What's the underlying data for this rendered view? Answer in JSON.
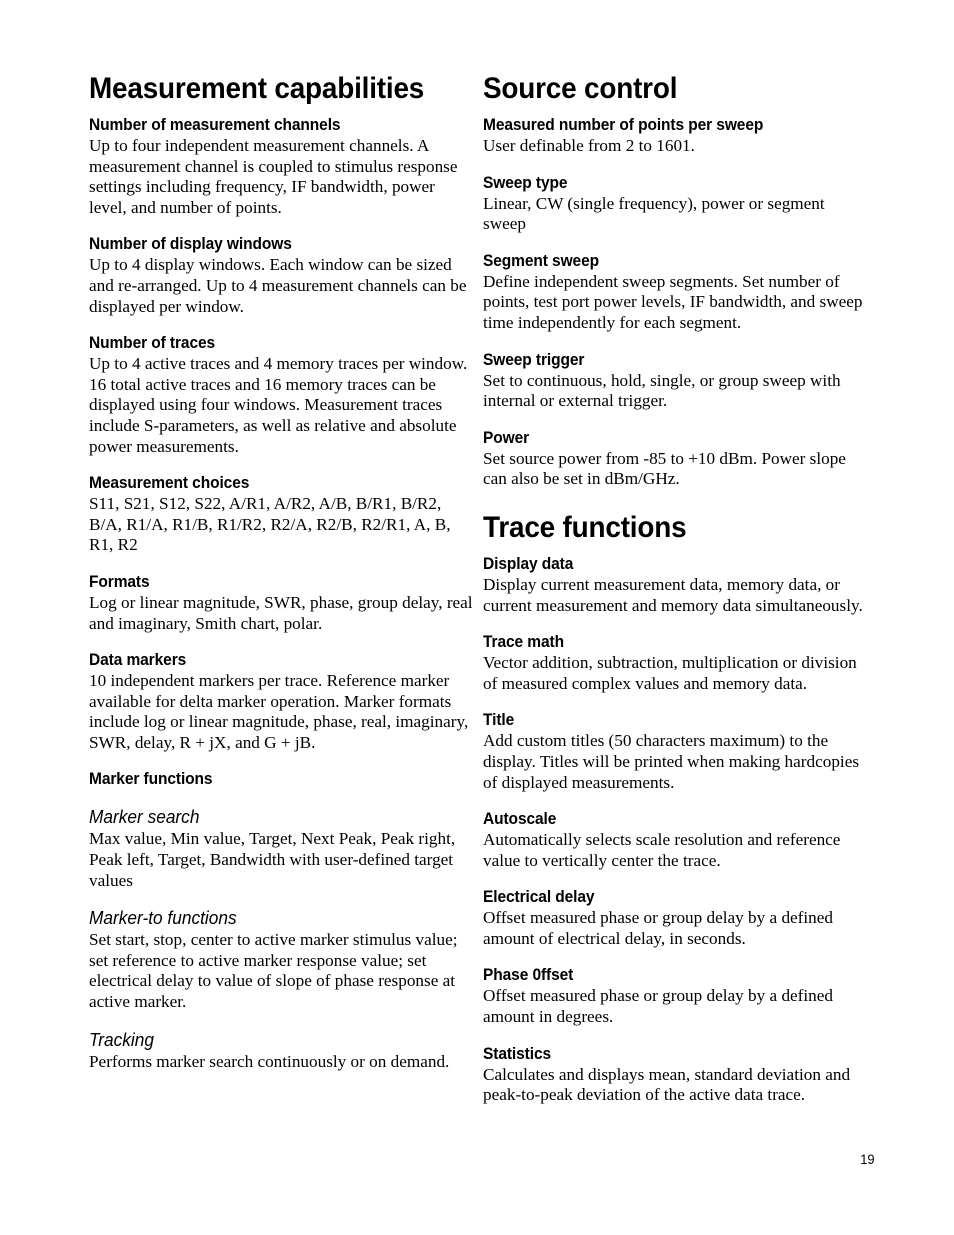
{
  "page": {
    "number": "19",
    "background": "#ffffff",
    "text_color": "#000000"
  },
  "left_column": {
    "title": "Measurement capabilities",
    "blocks": [
      {
        "heading": "Number of measurement channels",
        "body": "Up to four independent measurement channels. A measurement channel is coupled to stimulus response settings including frequency, IF bandwidth, power level, and number of points."
      },
      {
        "heading": "Number of display windows",
        "body": "Up to 4 display windows. Each window can be sized and re-arranged. Up to 4 measurement channels can be displayed per window."
      },
      {
        "heading": "Number of traces",
        "body": "Up to 4 active traces and 4 memory traces per window. 16 total active traces and 16 memory traces can be displayed using four windows. Measurement traces include S-parameters, as well as relative and absolute power measurements."
      },
      {
        "heading": "Measurement choices",
        "body": "S11, S21, S12, S22, A/R1, A/R2, A/B, B/R1, B/R2, B/A, R1/A, R1/B, R1/R2, R2/A, R2/B, R2/R1, A, B, R1, R2"
      },
      {
        "heading": "Formats",
        "body": "Log or linear magnitude, SWR, phase, group delay, real and imaginary, Smith chart, polar."
      },
      {
        "heading": "Data markers",
        "body": "10 independent markers per trace. Reference marker available for delta marker operation. Marker formats include log or linear magnitude, phase, real, imaginary, SWR, delay, R + jX, and G + jB."
      },
      {
        "heading": "Marker functions",
        "body": ""
      }
    ],
    "marker_subsections": [
      {
        "heading": "Marker search",
        "body": "Max value, Min value, Target, Next Peak, Peak right, Peak left, Target, Bandwidth with user-defined target values"
      },
      {
        "heading": "Marker-to functions",
        "body": "Set start, stop, center to active marker stimulus value; set reference to active marker response value; set electrical delay to value of slope of phase response at active marker."
      },
      {
        "heading": "Tracking",
        "body": "Performs marker search continuously or on demand."
      }
    ]
  },
  "right_column": {
    "title_1": "Source control",
    "blocks_1": [
      {
        "heading": "Measured number of points per sweep",
        "body": "User definable from 2 to 1601."
      },
      {
        "heading": "Sweep type",
        "body": "Linear, CW (single frequency), power or segment sweep"
      },
      {
        "heading": "Segment sweep",
        "body": "Define independent sweep segments. Set number of points, test port power levels, IF bandwidth, and sweep time independently for each segment."
      },
      {
        "heading": "Sweep trigger",
        "body": "Set to continuous, hold, single, or group sweep with internal or external trigger."
      },
      {
        "heading": "Power",
        "body": "Set source power from -85 to +10 dBm. Power slope can also be set in dBm/GHz."
      }
    ],
    "title_2": "Trace functions",
    "blocks_2": [
      {
        "heading": "Display data",
        "body": "Display current measurement data, memory data, or current measurement and memory data simultaneously."
      },
      {
        "heading": "Trace math",
        "body": "Vector addition, subtraction, multiplication or division of measured complex values and memory data."
      },
      {
        "heading": "Title",
        "body": "Add custom titles (50 characters maximum) to the display. Titles will be printed when making hardcopies of displayed measurements."
      },
      {
        "heading": "Autoscale",
        "body": "Automatically selects scale resolution and reference value to vertically center the trace."
      },
      {
        "heading": "Electrical delay",
        "body": "Offset measured phase or group delay by a defined amount of electrical delay, in seconds."
      },
      {
        "heading": "Phase 0ffset",
        "body": "Offset measured phase or group delay by a defined amount in degrees."
      },
      {
        "heading": "Statistics",
        "body": "Calculates and displays mean, standard deviation and peak-to-peak deviation of the active data trace."
      }
    ]
  }
}
